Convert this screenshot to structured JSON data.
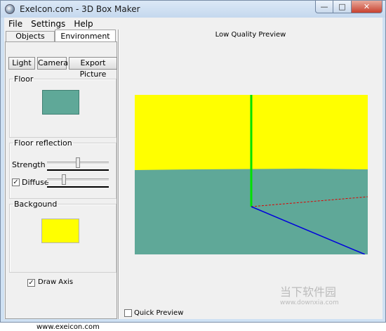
{
  "window": {
    "title": "ExeIcon.com - 3D Box Maker"
  },
  "menu": [
    "File",
    "Settings",
    "Help"
  ],
  "tabs": [
    {
      "label": "Objects",
      "active": false
    },
    {
      "label": "Environment",
      "active": true
    }
  ],
  "toolbar": {
    "light": "Light",
    "camera": "Camera",
    "export": "Export Picture"
  },
  "floor": {
    "legend": "Floor",
    "color": "#5fa898"
  },
  "reflection": {
    "legend": "Floor reflection",
    "strength_label": "Strength",
    "diffuse_label": "Diffuse",
    "diffuse_checked": true,
    "strength_fraction": 0.5,
    "diffuse_fraction": 0.25
  },
  "background": {
    "legend": "Backgound",
    "color": "#ffff00"
  },
  "draw_axis": {
    "label": "Draw Axis",
    "checked": true
  },
  "footer_url": "www.exeicon.com",
  "preview": {
    "title": "Low Quality Preview"
  },
  "quick_preview": {
    "label": "Quick Preview",
    "checked": false
  },
  "colors": {
    "sky": "#ffff00",
    "floor": "#5fa898",
    "axis_y": "#00e000",
    "axis_x": "#e00000",
    "axis_z": "#0000dd"
  },
  "watermark": {
    "text": "当下软件园",
    "url": "www.downxia.com"
  }
}
